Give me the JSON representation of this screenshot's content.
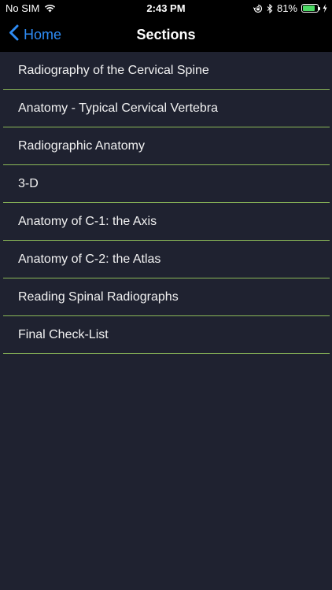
{
  "status_bar": {
    "carrier": "No SIM",
    "time": "2:43 PM",
    "battery_percent": "81%",
    "battery_level": 0.81,
    "icons": [
      "wifi-icon",
      "orientation-lock-icon",
      "bluetooth-icon",
      "battery-icon",
      "charging-bolt-icon"
    ]
  },
  "nav": {
    "back_label": "Home",
    "title": "Sections"
  },
  "sections": [
    {
      "label": "Radiography of the Cervical Spine"
    },
    {
      "label": "Anatomy - Typical Cervical Vertebra"
    },
    {
      "label": "Radiographic Anatomy"
    },
    {
      "label": "3-D"
    },
    {
      "label": "Anatomy of C-1: the Axis"
    },
    {
      "label": "Anatomy of C-2: the Atlas"
    },
    {
      "label": "Reading Spinal Radiographs"
    },
    {
      "label": "Final Check-List"
    }
  ],
  "colors": {
    "background": "#1f2230",
    "bar": "#000000",
    "accent": "#2e8cf5",
    "divider": "#8bb858",
    "battery": "#4cd964"
  }
}
